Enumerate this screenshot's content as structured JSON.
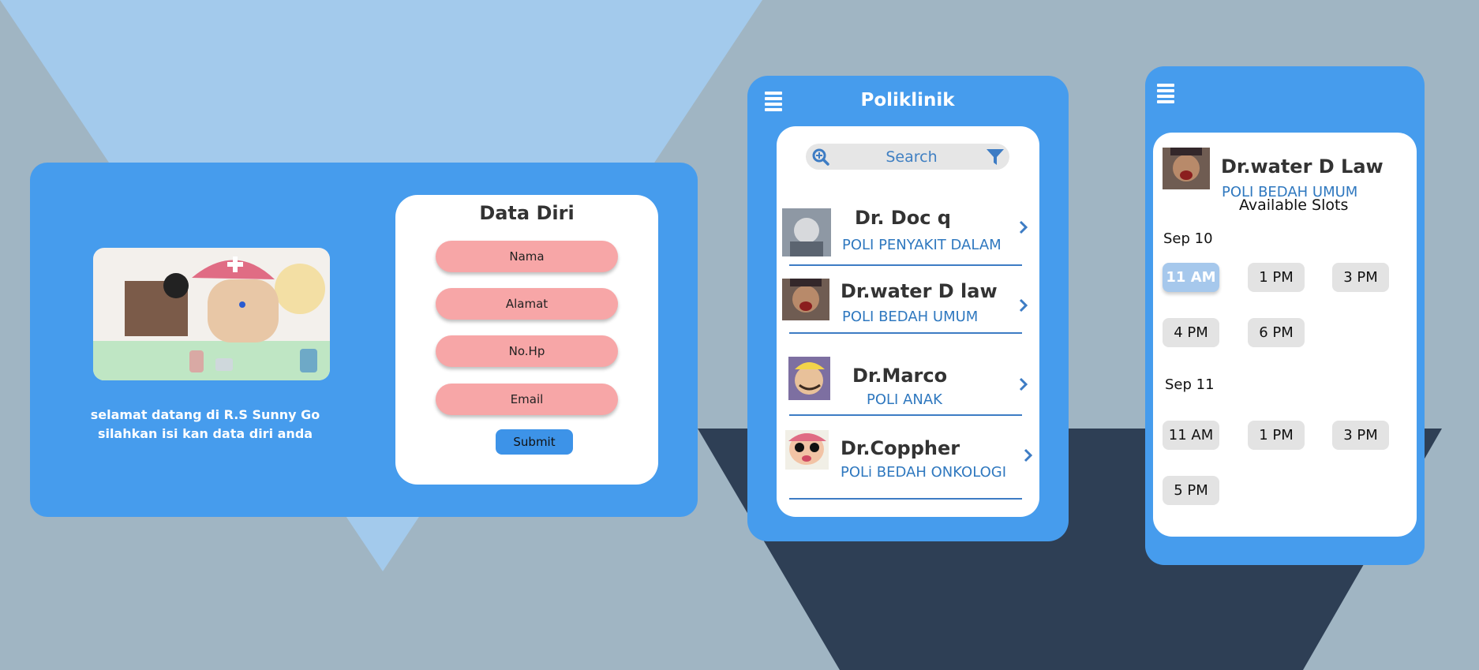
{
  "form_panel": {
    "title": "Data Diri",
    "welcome_line1": "selamat datang di R.S Sunny Go",
    "welcome_line2": "silahkan isi kan data diri anda",
    "fields": [
      {
        "label": "Nama"
      },
      {
        "label": "Alamat"
      },
      {
        "label": "No.Hp"
      },
      {
        "label": "Email"
      }
    ],
    "submit_label": "Submit",
    "colors": {
      "card": "#469ced",
      "field": "#f7a6a7",
      "submit": "#3d93e8"
    }
  },
  "poliklinik_panel": {
    "title": "Poliklinik",
    "menu_icon": "hamburger-icon",
    "search": {
      "placeholder": "Search",
      "left_icon": "zoom-in-icon",
      "right_icon": "filter-icon"
    },
    "doctors": [
      {
        "name": "Dr. Doc q",
        "poli": "POLI PENYAKIT DALAM"
      },
      {
        "name": "Dr.water D law",
        "poli": "POLI BEDAH UMUM"
      },
      {
        "name": "Dr.Marco",
        "poli": "POLI ANAK"
      },
      {
        "name": "Dr.Coppher",
        "poli": "POLi BEDAH ONKOLOGI"
      }
    ]
  },
  "schedule_panel": {
    "menu_icon": "hamburger-icon",
    "doctor_name": "Dr.water D Law",
    "doctor_poli": "POLI BEDAH UMUM",
    "available_label": "Available Slots",
    "days": [
      {
        "date": "Sep 10",
        "slots": [
          "11 AM",
          "1 PM",
          "3 PM",
          "4 PM",
          "6 PM"
        ],
        "selected": "11 AM"
      },
      {
        "date": "Sep 11",
        "slots": [
          "11 AM",
          "1 PM",
          "3 PM",
          "5 PM"
        ]
      }
    ]
  }
}
